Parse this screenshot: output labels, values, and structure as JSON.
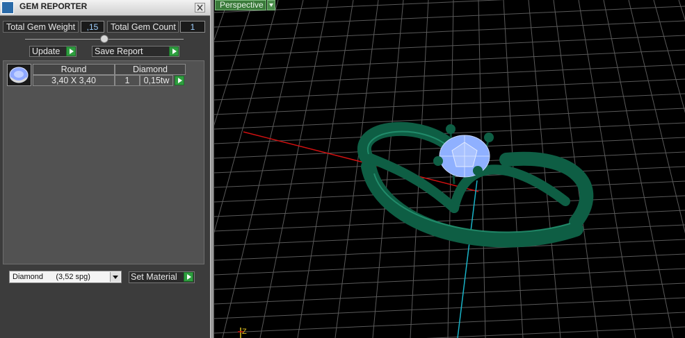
{
  "window": {
    "title": "GEM REPORTER"
  },
  "summary": {
    "total_weight_label": "Total Gem Weight",
    "total_weight_value": ",15",
    "total_count_label": "Total Gem Count",
    "total_count_value": "1"
  },
  "actions": {
    "update_label": "Update",
    "save_report_label": "Save Report"
  },
  "gems": [
    {
      "shape": "Round",
      "type": "Diamond",
      "size": "3,40 X 3,40",
      "count": "1",
      "weight": "0,15tw"
    }
  ],
  "material": {
    "selected": "Diamond      (3,52 spg)",
    "set_label": "Set Material"
  },
  "viewport": {
    "view_label": "Perspective",
    "axis_label": "Z"
  },
  "colors": {
    "ring": "#0e5e44",
    "gem": "#8fb0ff",
    "grid": "#5a5a5a",
    "x_axis": "#d01010",
    "z_axis": "#19b3c7"
  }
}
